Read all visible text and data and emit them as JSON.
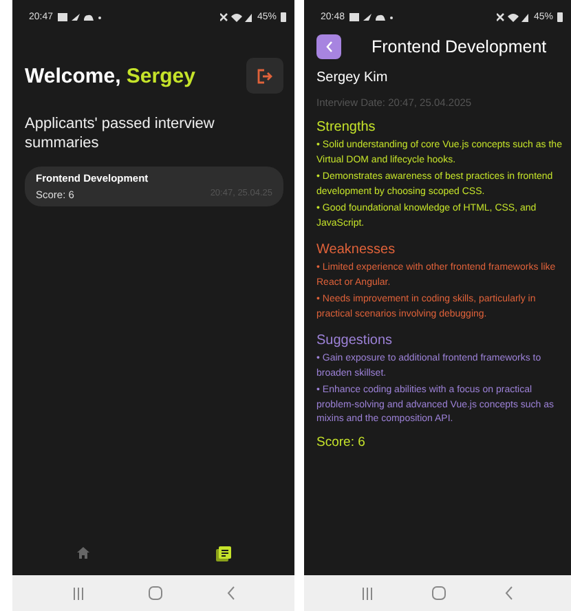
{
  "left_screen": {
    "status_bar": {
      "time": "20:47",
      "battery": "45%"
    },
    "greeting": {
      "prefix": "Welcome, ",
      "name": "Sergey"
    },
    "subtitle": "Applicants' passed interview summaries",
    "summaries": [
      {
        "title": "Frontend Development",
        "score": "Score: 6",
        "date": "20:47, 25.04.25"
      }
    ],
    "bottom_tabs": [
      {
        "kind": "home",
        "selected": false
      },
      {
        "kind": "summaries",
        "selected": true
      }
    ]
  },
  "right_screen": {
    "status_bar": {
      "time": "20:48",
      "battery": "45%"
    },
    "title": "Frontend Development",
    "candidate": "Sergey Kim",
    "interview_date": "Interview Date: 20:47, 25.04.2025",
    "sections": [
      {
        "kind": "strengths",
        "heading": "Strengths",
        "items": [
          "• Solid understanding of core Vue.js concepts such as the Virtual DOM and lifecycle hooks.",
          "• Demonstrates awareness of best practices in frontend development by choosing scoped CSS.",
          "• Good foundational knowledge of HTML, CSS, and JavaScript."
        ]
      },
      {
        "kind": "weaknesses",
        "heading": "Weaknesses",
        "items": [
          "• Limited experience with other frontend frameworks like React or Angular.",
          "• Needs improvement in coding skills, particularly in practical scenarios involving debugging."
        ]
      },
      {
        "kind": "suggestions",
        "heading": "Suggestions",
        "items": [
          "• Gain exposure to additional frontend frameworks to broaden skillset.",
          "• Enhance coding abilities with a focus on practical problem-solving and advanced Vue.js concepts such as mixins and the composition API."
        ]
      }
    ],
    "score": "Score: 6"
  }
}
